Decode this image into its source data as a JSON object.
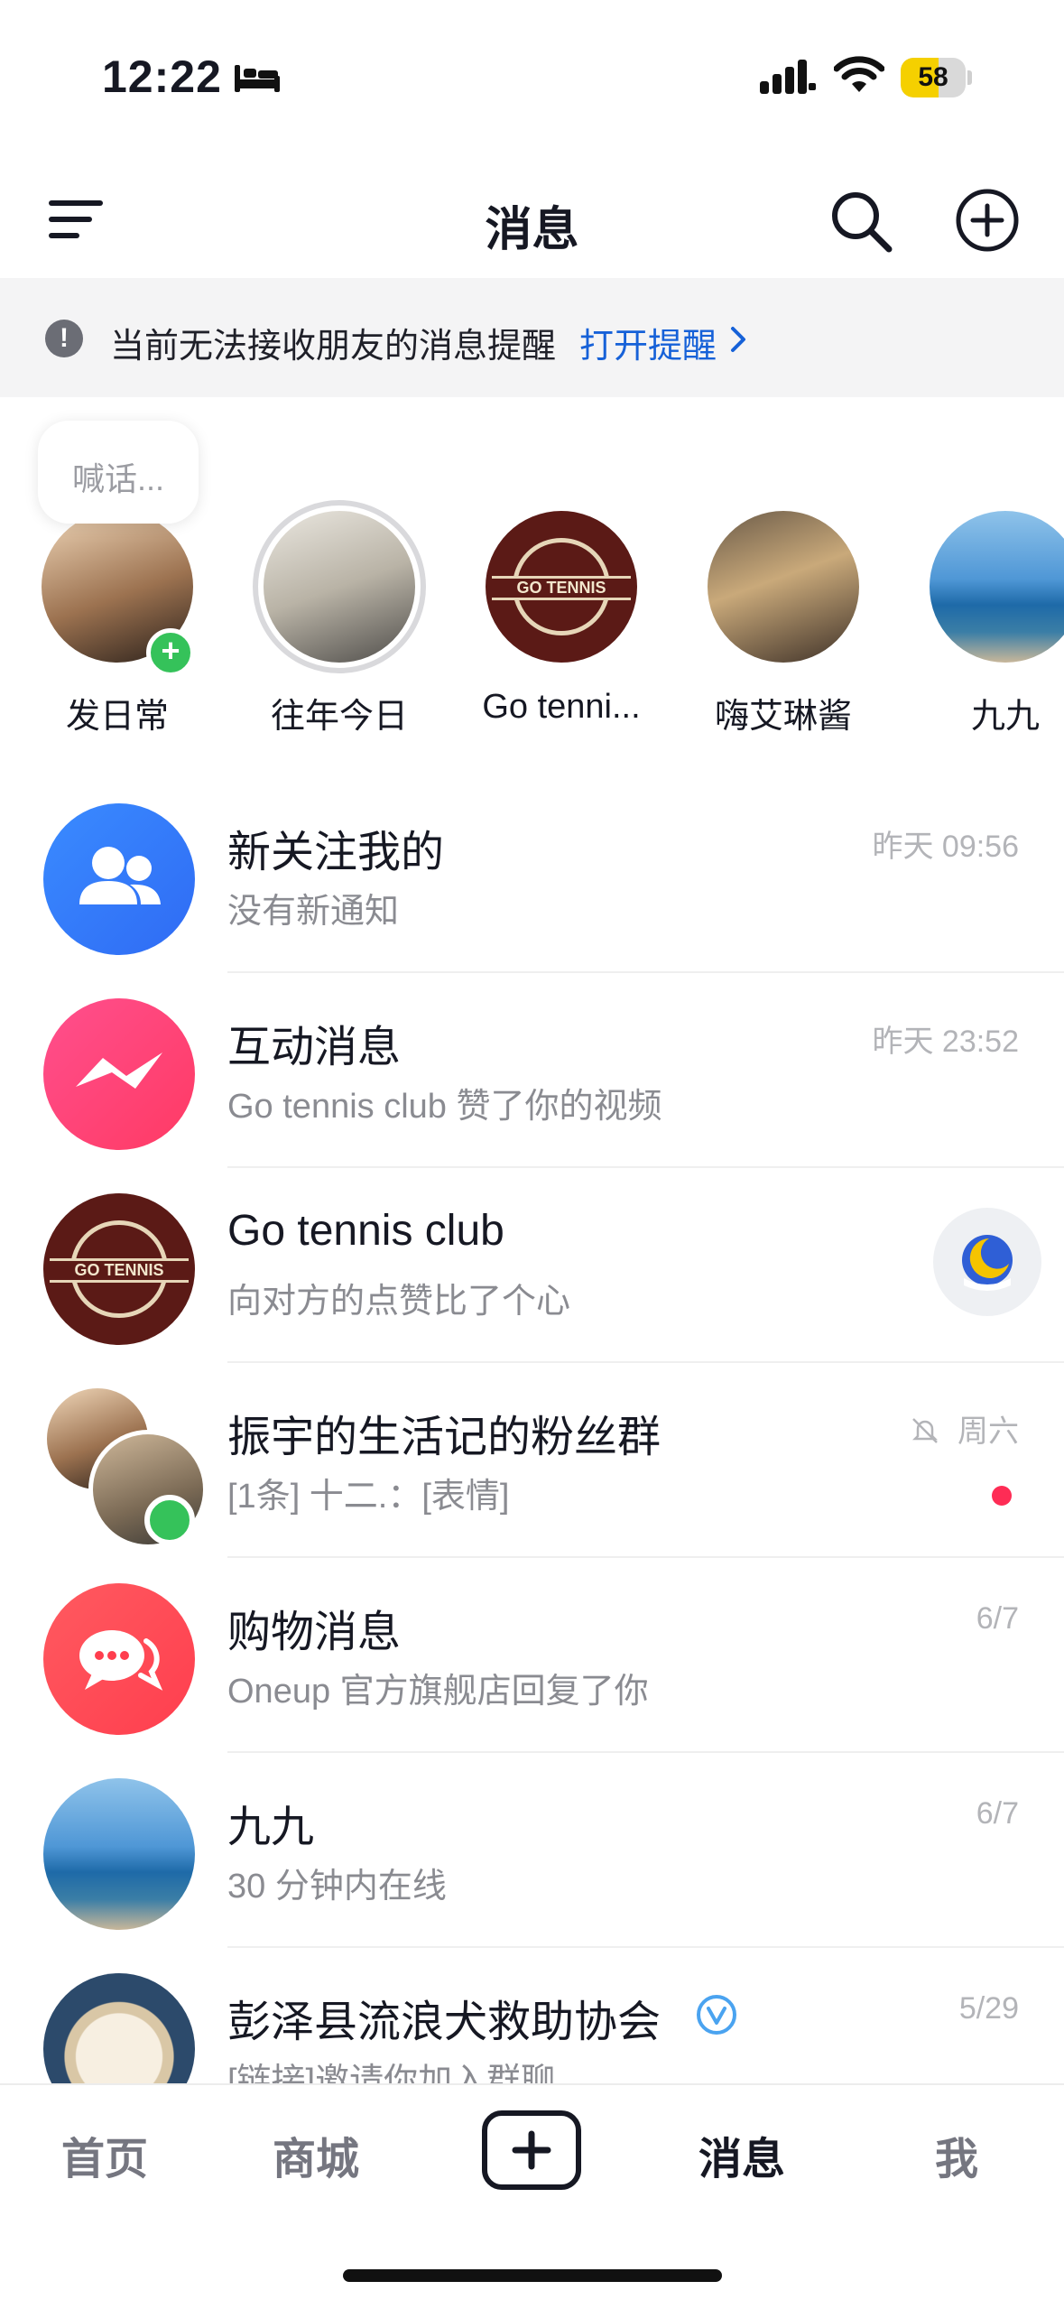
{
  "status_bar": {
    "time": "12:22",
    "battery": 58
  },
  "header": {
    "title": "消息"
  },
  "notice": {
    "text": "当前无法接收朋友的消息提醒",
    "link": "打开提醒"
  },
  "bubble": {
    "text": "喊话..."
  },
  "stories": [
    {
      "label": "发日常",
      "icon": "add-story-badge"
    },
    {
      "label": "往年今日"
    },
    {
      "label": "Go tenni...",
      "badge_text": "GO TENNIS"
    },
    {
      "label": "嗨艾琳酱"
    },
    {
      "label": "九九"
    }
  ],
  "conversations": [
    {
      "title": "新关注我的",
      "subtitle": "没有新通知",
      "time": "昨天 09:56",
      "icon": "people-icon"
    },
    {
      "title": "互动消息",
      "subtitle": "Go tennis club 赞了你的视频",
      "time": "昨天 23:52",
      "icon": "lightning-chat-icon"
    },
    {
      "title": "Go tennis club",
      "subtitle": "向对方的点赞比了个心",
      "time": "",
      "badge_text": "GO TENNIS",
      "action_icon": "moon-sticker-icon"
    },
    {
      "title": "振宇的生活记的粉丝群",
      "subtitle": "[1条] 十二.：[表情]",
      "time": "周六",
      "muted": true,
      "unread": true
    },
    {
      "title": "购物消息",
      "subtitle": "Oneup 官方旗舰店回复了你",
      "time": "6/7",
      "icon": "chat-bubbles-icon"
    },
    {
      "title": "九九",
      "subtitle": "30 分钟内在线",
      "time": "6/7"
    },
    {
      "title": "彭泽县流浪犬救助协会",
      "subtitle": "[链接]邀请你加入群聊",
      "time": "5/29",
      "verified": true
    }
  ],
  "tabbar": {
    "tabs": [
      "首页",
      "商城",
      "消息",
      "我"
    ],
    "active": "消息"
  }
}
